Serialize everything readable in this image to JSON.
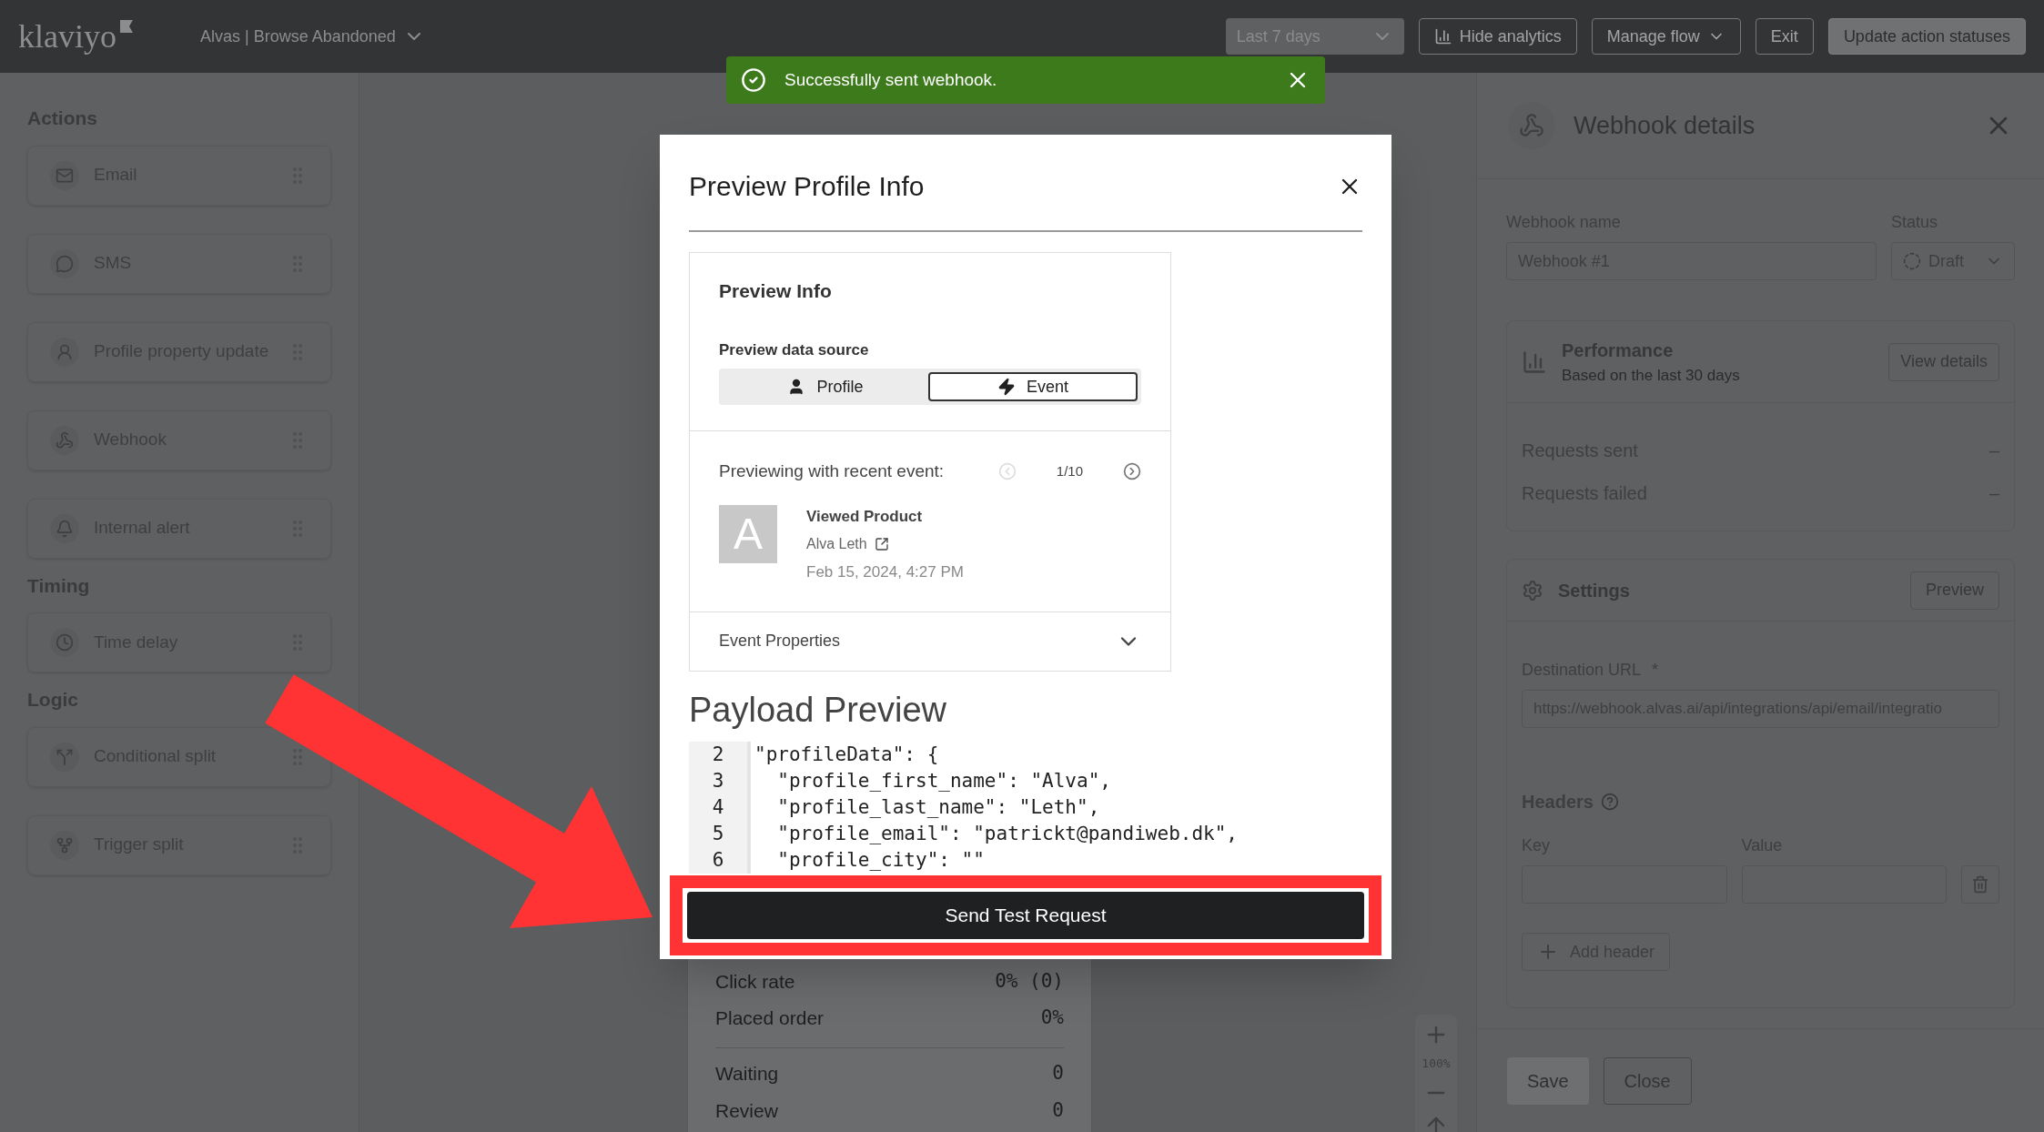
{
  "top_bar": {
    "logo": "klaviyo",
    "flow_name": "Alvas | Browse Abandoned",
    "date_range": "Last 7 days",
    "buttons": [
      {
        "label": "Hide analytics",
        "kind": "chart"
      },
      {
        "label": "Manage flow",
        "kind": "menu"
      },
      {
        "label": "Exit",
        "kind": "plain"
      },
      {
        "label": "Update action statuses",
        "kind": "primary"
      }
    ]
  },
  "sidebar": {
    "sections": [
      {
        "title": "Actions",
        "items": [
          {
            "label": "Email"
          },
          {
            "label": "SMS"
          },
          {
            "label": "Profile property update"
          },
          {
            "label": "Webhook"
          },
          {
            "label": "Internal alert"
          }
        ]
      },
      {
        "title": "Timing",
        "items": [
          {
            "label": "Time delay"
          }
        ]
      },
      {
        "title": "Logic",
        "items": [
          {
            "label": "Conditional split"
          },
          {
            "label": "Trigger split"
          }
        ]
      }
    ]
  },
  "toast": {
    "message": "Successfully sent webhook."
  },
  "canvas": {
    "node_stats": [
      {
        "label": "Click rate",
        "value": "0% (0)"
      },
      {
        "label": "Placed order",
        "value": "0%"
      },
      {
        "label": "Waiting",
        "value": "0"
      },
      {
        "label": "Review",
        "value": "0"
      }
    ],
    "zoom": "100%"
  },
  "modal": {
    "title": "Preview Profile Info",
    "preview_info": {
      "title": "Preview Info",
      "data_source_label": "Preview data source",
      "sources": [
        {
          "label": "Profile",
          "selected": false
        },
        {
          "label": "Event",
          "selected": true
        }
      ],
      "recent_label": "Previewing with recent event:",
      "pager": {
        "text": "1/10",
        "prev": {
          "disabled": true
        },
        "next": {
          "disabled": false
        }
      },
      "event": {
        "avatar_letter": "A",
        "name": "Viewed Product",
        "person": "Alva Leth",
        "time": "Feb 15, 2024, 4:27 PM"
      },
      "properties": {
        "label": "Event Properties",
        "expanded": false
      }
    },
    "payload_title": "Payload Preview",
    "code_lines": [
      {
        "number": "2",
        "text": "\"profileData\": {"
      },
      {
        "number": "3",
        "text": "  \"profile_first_name\": \"Alva\","
      },
      {
        "number": "4",
        "text": "  \"profile_last_name\": \"Leth\","
      },
      {
        "number": "5",
        "text": "  \"profile_email\": \"patrickt@pandiweb.dk\","
      },
      {
        "number": "6",
        "text": "  \"profile_city\": \"\""
      }
    ],
    "send_button": "Send Test Request"
  },
  "details_panel": {
    "title": "Webhook details",
    "name_label": "Webhook name",
    "name_value": "Webhook #1",
    "status_label": "Status",
    "status_value": "Draft",
    "performance": {
      "title": "Performance",
      "subtitle": "Based on the last 30 days",
      "button": "View details",
      "rows": [
        {
          "label": "Requests sent",
          "value": "–"
        },
        {
          "label": "Requests failed",
          "value": "–"
        }
      ]
    },
    "settings": {
      "title": "Settings",
      "button": "Preview",
      "url_label": "Destination URL",
      "url_required": "*",
      "url_value": "https://webhook.alvas.ai/api/integrations/api/email/integratio",
      "headers_label": "Headers",
      "key_label": "Key",
      "value_label": "Value",
      "add_button": "Add header"
    },
    "save": {
      "label": "Save",
      "disabled": true
    },
    "close": "Close"
  }
}
